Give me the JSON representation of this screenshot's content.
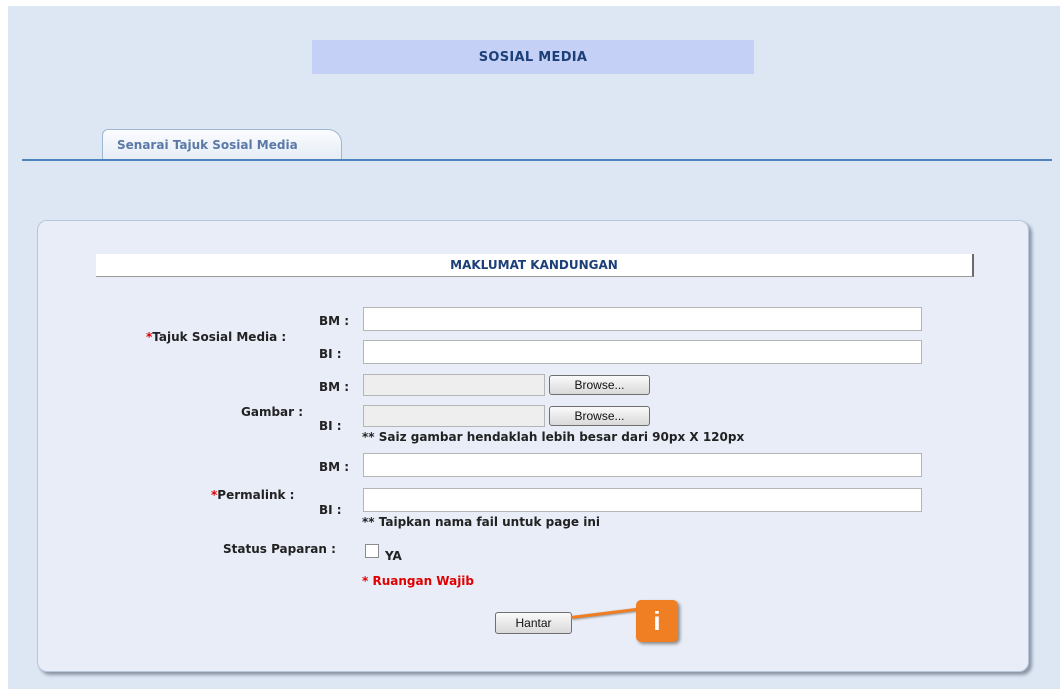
{
  "page": {
    "title": "SOSIAL MEDIA",
    "tab": "Senarai Tajuk Sosial Media"
  },
  "form": {
    "section_title": "MAKLUMAT KANDUNGAN",
    "bm_label": "BM :",
    "bi_label": "BI :",
    "tajuk": {
      "required_mark": "*",
      "label": "Tajuk Sosial Media :",
      "bm_value": "",
      "bi_value": ""
    },
    "gambar": {
      "label": "Gambar :",
      "browse_label": "Browse...",
      "note": "** Saiz gambar hendaklah lebih besar dari 90px X 120px"
    },
    "permalink": {
      "required_mark": "*",
      "label": "Permalink :",
      "bm_value": "",
      "bi_value": "",
      "note": "** Taipkan nama fail untuk page ini"
    },
    "status": {
      "label": "Status Paparan :",
      "checkbox_label": "YA",
      "checked": false
    },
    "required_note": "* Ruangan Wajib",
    "submit_label": "Hantar"
  },
  "callout": {
    "label": "i",
    "color": "#f07f24"
  },
  "colors": {
    "background": "#dde7f3",
    "title_bar": "#c4d0f6",
    "title_text": "#1d3f78",
    "tab_line": "#4d84bd",
    "required": "#e00000"
  }
}
